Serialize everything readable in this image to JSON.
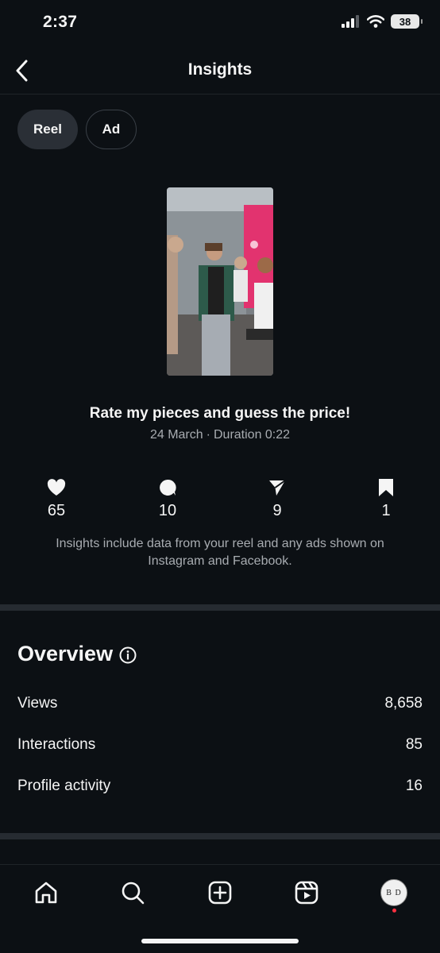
{
  "status_bar": {
    "time": "2:37",
    "battery": "38"
  },
  "header": {
    "title": "Insights",
    "back_icon": "chevron-left-icon"
  },
  "tabs": [
    {
      "label": "Reel",
      "selected": true
    },
    {
      "label": "Ad",
      "selected": false
    }
  ],
  "reel": {
    "title": "Rate my pieces and guess the price!",
    "date": "24 March",
    "separator": "·",
    "duration": "Duration 0:22"
  },
  "stats": {
    "likes": {
      "icon": "heart-icon",
      "value": "65"
    },
    "comments": {
      "icon": "comment-icon",
      "value": "10"
    },
    "shares": {
      "icon": "send-icon",
      "value": "9"
    },
    "saves": {
      "icon": "bookmark-icon",
      "value": "1"
    }
  },
  "note": "Insights include data from your reel and any ads shown on Instagram and Facebook.",
  "overview": {
    "title": "Overview",
    "rows": [
      {
        "label": "Views",
        "value": "8,658"
      },
      {
        "label": "Interactions",
        "value": "85"
      },
      {
        "label": "Profile activity",
        "value": "16"
      }
    ]
  },
  "bottom_nav": {
    "items": [
      "home-icon",
      "search-icon",
      "create-icon",
      "reels-icon",
      "profile-avatar"
    ],
    "avatar_initials": "B D"
  },
  "colors": {
    "background": "#0c1014",
    "selected_tab": "#2a2f36",
    "muted_text": "#a8acb1",
    "notification": "#ff3040"
  }
}
